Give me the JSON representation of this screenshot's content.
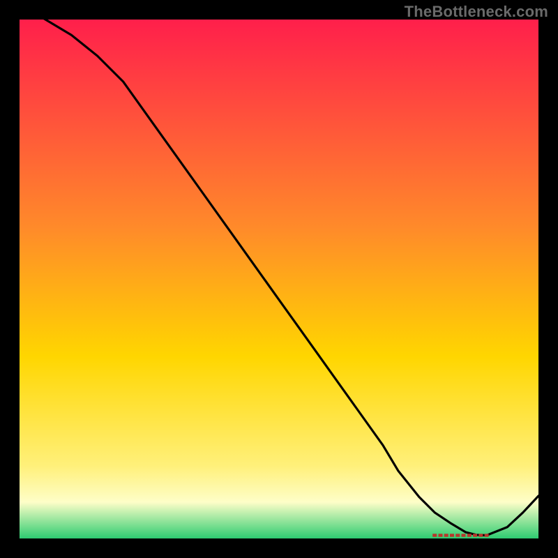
{
  "watermark": "TheBottleneck.com",
  "colors": {
    "top": "#FF1F4B",
    "mid_upper": "#FF8A2A",
    "mid": "#FFD600",
    "mid_lower": "#FFF07A",
    "pale": "#FEFEC8",
    "green": "#2ECC71",
    "line": "#000000",
    "red_marker": "#B8362B"
  },
  "chart_data": {
    "type": "line",
    "title": "",
    "xlabel": "",
    "ylabel": "",
    "xlim": [
      0,
      100
    ],
    "ylim": [
      0,
      100
    ],
    "series": [
      {
        "name": "bottleneck-curve",
        "x": [
          0,
          5,
          10,
          15,
          20,
          25,
          30,
          35,
          40,
          45,
          50,
          55,
          60,
          65,
          70,
          73,
          77,
          80,
          83,
          86,
          88,
          90,
          94,
          97,
          100
        ],
        "y": [
          103,
          100,
          97,
          93,
          88,
          81,
          74,
          67,
          60,
          53,
          46,
          39,
          32,
          25,
          18,
          13,
          8,
          5,
          3,
          1.2,
          0.7,
          0.6,
          2.2,
          5.0,
          8.2
        ]
      }
    ],
    "annotations": [
      {
        "name": "optimal-region",
        "x_start": 80,
        "x_end": 90,
        "y": 0.6
      }
    ],
    "gradient_bands": [
      {
        "y": 100,
        "color": "#FF1F4B"
      },
      {
        "y": 60,
        "color": "#FF8A2A"
      },
      {
        "y": 35,
        "color": "#FFD600"
      },
      {
        "y": 14,
        "color": "#FFF07A"
      },
      {
        "y": 7,
        "color": "#FEFEC8"
      },
      {
        "y": 0,
        "color": "#2ECC71"
      }
    ]
  }
}
